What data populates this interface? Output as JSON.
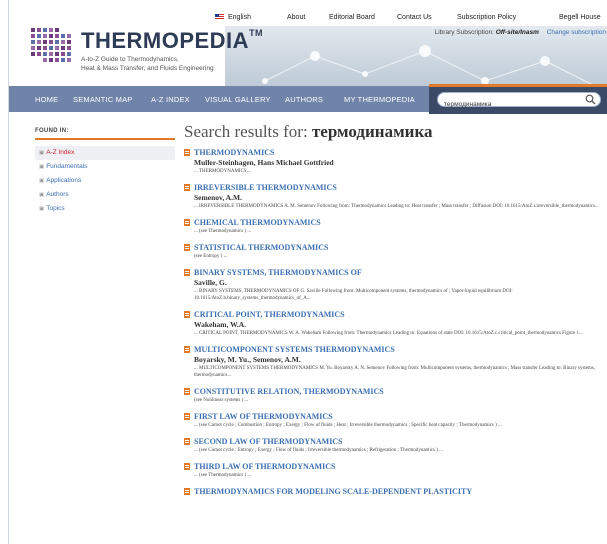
{
  "toplinks": {
    "english": "English",
    "about": "About",
    "editorial_board": "Editorial Board",
    "contact_us": "Contact Us",
    "subscription_policy": "Subscription Policy",
    "begell_house": "Begell House"
  },
  "banner": {
    "library_label": "Library Subscription:",
    "library_value": "Off-site/Inasm",
    "change_subscription": "Change subscription"
  },
  "logo": {
    "title": "THERMOPEDIA",
    "trademark": "TM",
    "tagline_1": "A-to-Z Guide to Thermodynamics,",
    "tagline_2": "Heat & Mass Transfer, and Fluids Engineering"
  },
  "nav": {
    "items": [
      "HOME",
      "SEMANTIC MAP",
      "A-Z INDEX",
      "VISUAL GALLERY",
      "AUTHORS",
      "MY THERMOPEDIA"
    ]
  },
  "search": {
    "value": "термодинамика",
    "placeholder": ""
  },
  "sidebar": {
    "found_in": "FOUND IN:",
    "items": [
      {
        "label": "A-Z Index",
        "active": true
      },
      {
        "label": "Fundamentals",
        "active": false
      },
      {
        "label": "Applications",
        "active": false
      },
      {
        "label": "Authors",
        "active": false
      },
      {
        "label": "Topics",
        "active": false
      }
    ]
  },
  "results": {
    "heading_prefix": "Search results for:",
    "heading_query": "термодинамика",
    "items": [
      {
        "title": "THERMODYNAMICS",
        "author": "Muller-Steinhagen, Hans Michael Gottfried",
        "snippet": "... THERMODYNAMICS..."
      },
      {
        "title": "IRREVERSIBLE THERMODYNAMICS",
        "author": "Semenov, A.M.",
        "snippet": "... IRREVERSIBLE THERMODYNAMICS A. M. Semenov Following from: Thermodynamics Leading to: Heat transfer ; Mass transfer ; Diffusion DOI: 10.1615/AtoZ.i.irreversible_thermodynamics..."
      },
      {
        "title": "CHEMICAL THERMODYNAMICS",
        "author": "",
        "snippet": "... (see Thermodynamics ) ..."
      },
      {
        "title": "STATISTICAL THERMODYNAMICS",
        "author": "",
        "snippet": "(see Entropy ) ..."
      },
      {
        "title": "BINARY SYSTEMS, THERMODYNAMICS OF",
        "author": "Saville, G.",
        "snippet": "... BINARY SYSTEMS, THERMODYNAMICS OF G. Saville Following from: Multicomponent systems, thermodynamics of ; Vapor-liquid equilibrium DOI: 10.1615/AtoZ.b.binary_systems_thermodynamics_of_A..."
      },
      {
        "title": "CRITICAL POINT, THERMODYNAMICS",
        "author": "Wakeham, W.A.",
        "snippet": "... CRITICAL POINT, THERMODYNAMICS W. A. Wakeham Following from: Thermodynamics Leading to: Equations of state DOI: 10.1615/AtoZ.c.critical_point_thermodynamics Figure 1..."
      },
      {
        "title": "MULTICOMPONENT SYSTEMS THERMODYNAMICS",
        "author": "Boyarsky, M. Yu., Semenov, A.M.",
        "snippet": "... MULTICOMPONENT SYSTEMS THERMODYNAMICS M. Yu. Boyarsky A. N. Semenov Following from: Multicomponent systems, thermodynamics ; Mass transfer Leading to: Binary systems, thermodynamics..."
      },
      {
        "title": "CONSTITUTIVE RELATION, THERMODYNAMICS",
        "author": "",
        "snippet": "(see Nonlinear systems ) ..."
      },
      {
        "title": "FIRST LAW OF THERMODYNAMICS",
        "author": "",
        "snippet": "... (see Carnot cycle ; Combustion ; Entropy ; Exergy ; Flow of fluids ; Heat ; Irreversible thermodynamics ; Specific heat capacity ; Thermodynamics ) ..."
      },
      {
        "title": "SECOND LAW OF THERMODYNAMICS",
        "author": "",
        "snippet": "... (see Carnot cycle ; Entropy ; Exergy ; Flow of fluids ; Irreversible thermodynamics ; Refrigeration ; Thermodynamics ) ..."
      },
      {
        "title": "THIRD LAW OF THERMODYNAMICS",
        "author": "",
        "snippet": "... (see Thermodynamics ) ..."
      },
      {
        "title": "THERMODYNAMICS FOR MODELING SCALE-DEPENDENT PLASTICITY",
        "author": "",
        "snippet": ""
      }
    ]
  },
  "colors": {
    "nav_bg": "#6f84a8",
    "accent_orange": "#e07a2a",
    "link_blue": "#3a6fb3",
    "search_bg": "#3b4a66"
  }
}
